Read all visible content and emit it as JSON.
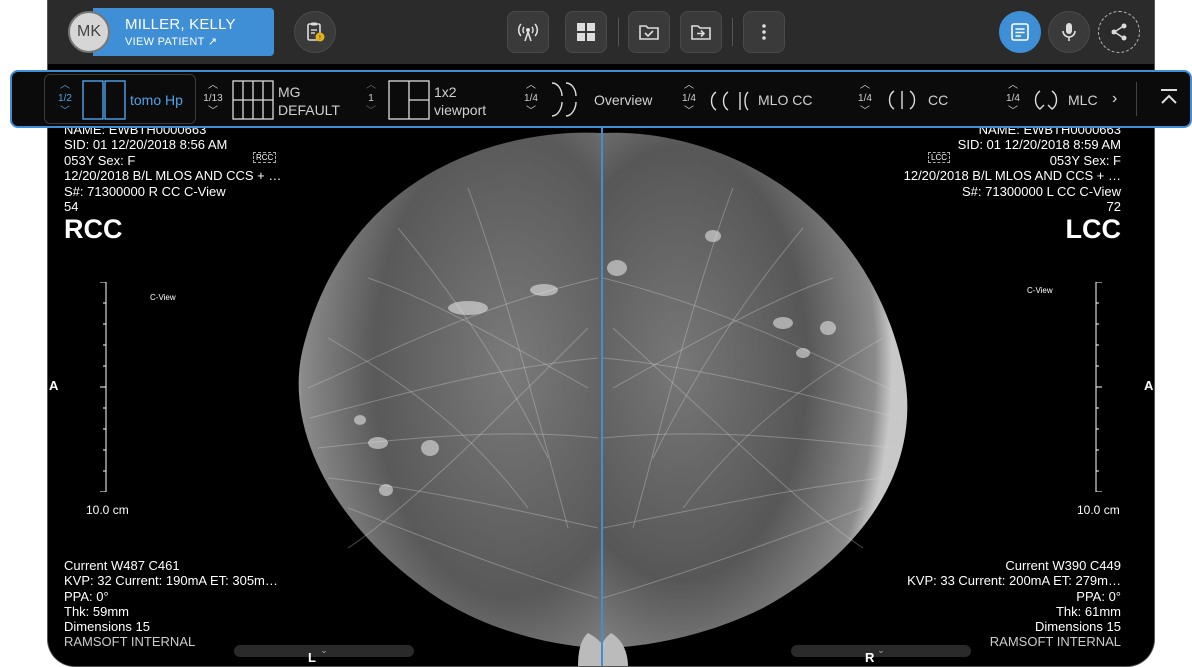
{
  "patient": {
    "initials": "MK",
    "name": "MILLER, KELLY",
    "view_link": "VIEW PATIENT ↗"
  },
  "toolbar": {
    "icons": [
      "clipboard-badge-icon",
      "broadcast-icon",
      "grid-icon",
      "folder-check-icon",
      "folder-export-icon",
      "more-vert-icon",
      "report-icon",
      "microphone-icon",
      "share-icon"
    ]
  },
  "hanging_protocols": [
    {
      "page": "1/2",
      "label": "tomo Hp",
      "active": true
    },
    {
      "page": "1/13",
      "label_line1": "MG",
      "label_line2": "DEFAULT"
    },
    {
      "page": "1",
      "label_line1": "1x2",
      "label_line2": "viewport"
    },
    {
      "page": "1/4",
      "label": "Overview"
    },
    {
      "page": "1/4",
      "label": "MLO CC"
    },
    {
      "page": "1/4",
      "label": "CC"
    },
    {
      "page": "1/4",
      "label": "MLC"
    }
  ],
  "left_viewport": {
    "name": "NAME: EWBTH0000663",
    "sid": "SID: 01  12/20/2018 8:56 AM",
    "age_sex": "053Y  Sex: F",
    "study": "12/20/2018  B/L MLOS AND CCS + …",
    "series": "S#: 71300000  R CC C-View",
    "image_num": "54",
    "view_label": "RCC",
    "tag": "RCC",
    "cview": "C-View",
    "scale": "10.0 cm",
    "orientation": "A",
    "bottom_lines": [
      "Current  W487 C461",
      "KVP: 32  Current: 190mA  ET: 305m…",
      "PPA: 0°",
      "Thk: 59mm",
      "Dimensions 15"
    ],
    "institution": "RAMSOFT INTERNAL",
    "bottom_orient": "L"
  },
  "right_viewport": {
    "name": "NAME: EWBTH0000663",
    "sid": "SID: 01  12/20/2018 8:59 AM",
    "age_sex": "053Y  Sex: F",
    "study": "12/20/2018  B/L MLOS AND CCS + …",
    "series": "S#: 71300000  L CC C-View",
    "image_num": "72",
    "view_label": "LCC",
    "tag": "LCC",
    "cview": "C-View",
    "scale": "10.0 cm",
    "orientation": "A",
    "bottom_lines": [
      "Current  W390 C449",
      "KVP: 33  Current: 200mA  ET: 279m…",
      "PPA: 0°",
      "Thk: 61mm",
      "Dimensions 15"
    ],
    "institution": "RAMSOFT INTERNAL",
    "bottom_orient": "R"
  },
  "colors": {
    "accent": "#3f8fd6",
    "topbar": "#2b2b2b",
    "viewport_bg": "#000000"
  }
}
